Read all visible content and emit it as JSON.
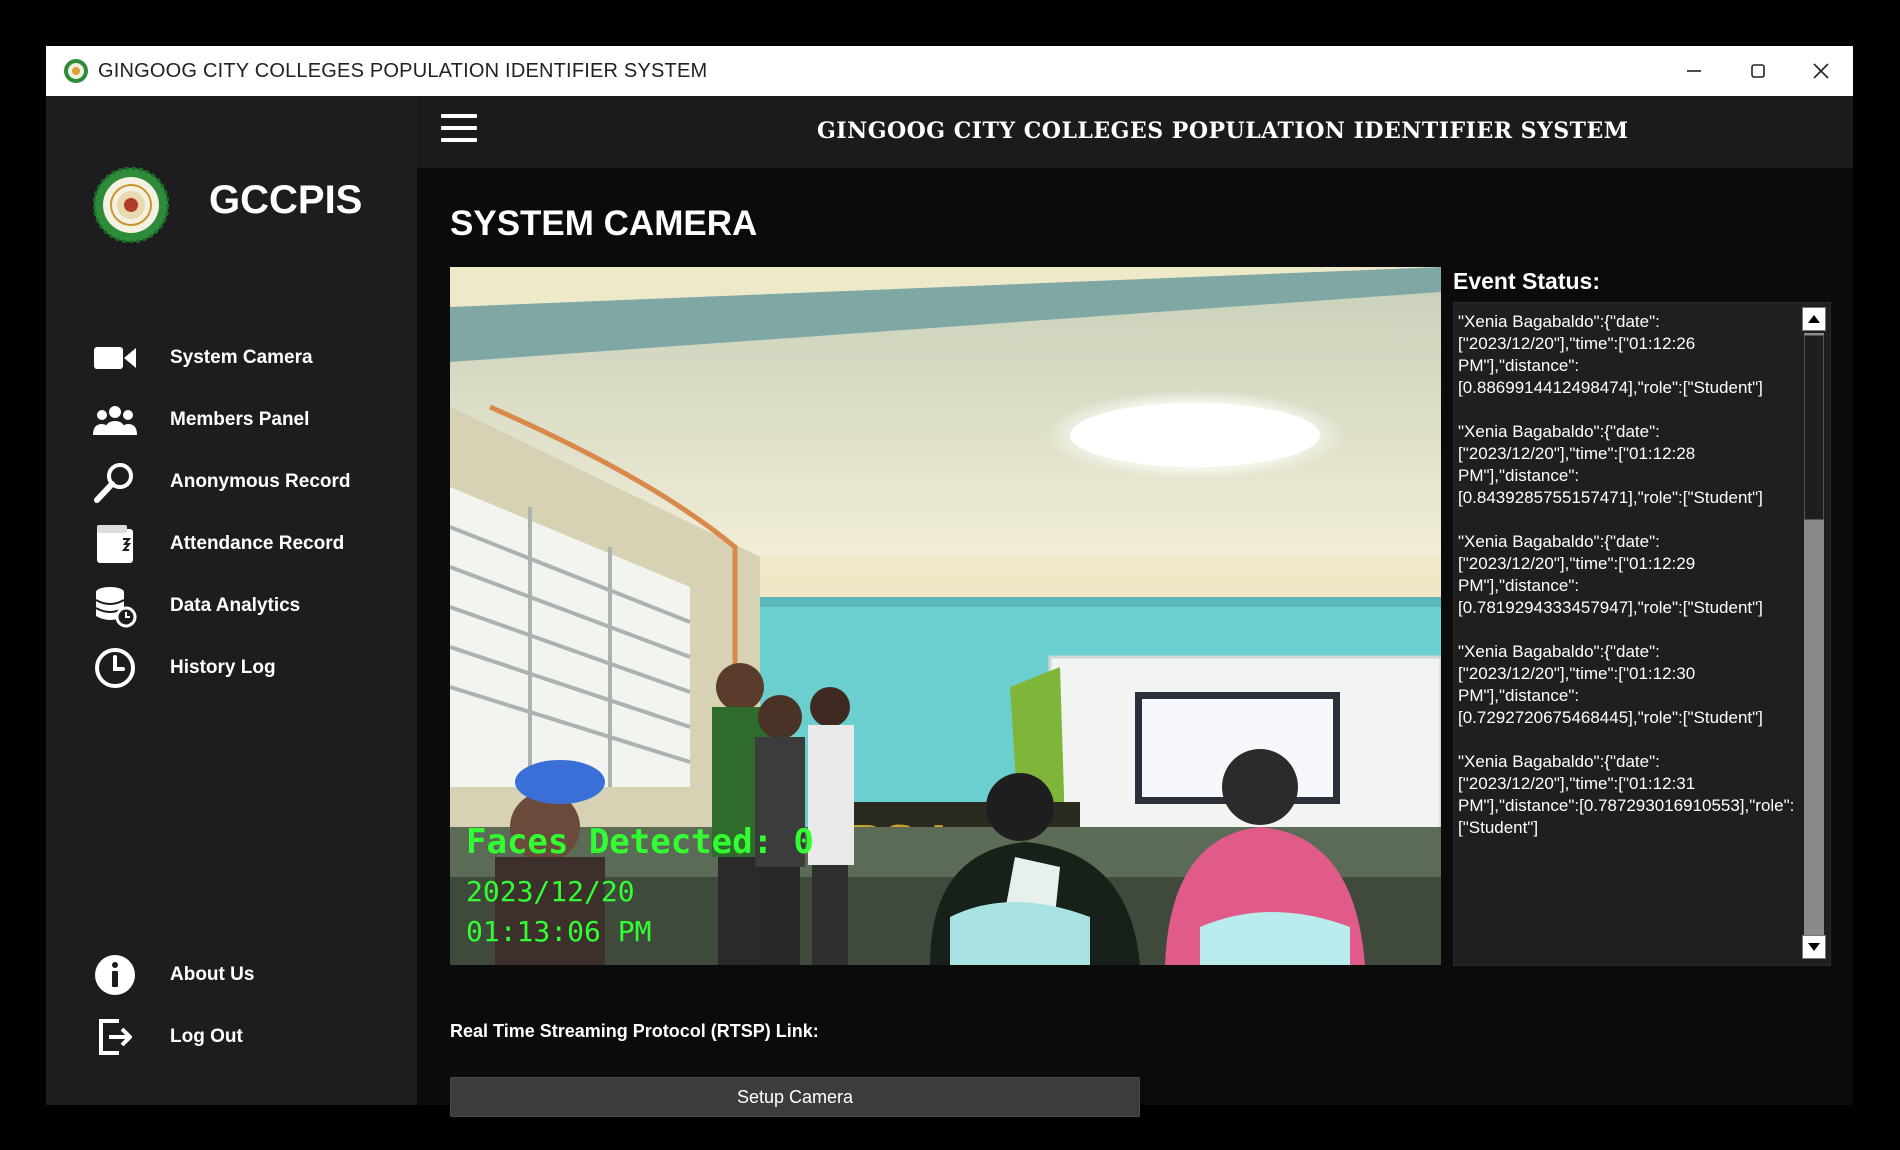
{
  "window": {
    "title": "GINGOOG CITY COLLEGES POPULATION IDENTIFIER SYSTEM",
    "minimize_icon": "minimize-icon",
    "maximize_icon": "maximize-icon",
    "close_icon": "close-icon"
  },
  "sidebar": {
    "brand": "GCCPIS",
    "items": [
      {
        "label": "System Camera",
        "icon": "video-camera-icon"
      },
      {
        "label": "Members Panel",
        "icon": "users-group-icon"
      },
      {
        "label": "Anonymous Record",
        "icon": "magnifier-icon"
      },
      {
        "label": "Attendance Record",
        "icon": "attendance-book-icon"
      },
      {
        "label": "Data Analytics",
        "icon": "database-analytics-icon"
      },
      {
        "label": "History Log",
        "icon": "clock-icon"
      }
    ],
    "bottom_items": [
      {
        "label": "About Us",
        "icon": "info-icon"
      },
      {
        "label": "Log Out",
        "icon": "logout-icon"
      }
    ]
  },
  "header": {
    "title": "GINGOOG CITY COLLEGES POPULATION IDENTIFIER SYSTEM"
  },
  "main": {
    "page_title": "SYSTEM CAMERA",
    "camera": {
      "faces_detected": "Faces Detected: 0",
      "date": "2023/12/20",
      "time": "01:13:06 PM"
    },
    "event_status": {
      "label": "Event Status:",
      "entries": [
        "\"Xenia Bagabaldo\":{\"date\":[\"2023/12/20\"],\"time\":[\"01:12:26 PM\"],\"distance\":[0.8869914412498474],\"role\":[\"Student\"]",
        "\"Xenia Bagabaldo\":{\"date\":[\"2023/12/20\"],\"time\":[\"01:12:28 PM\"],\"distance\":[0.8439285755157471],\"role\":[\"Student\"]",
        "\"Xenia Bagabaldo\":{\"date\":[\"2023/12/20\"],\"time\":[\"01:12:29 PM\"],\"distance\":[0.7819294333457947],\"role\":[\"Student\"]",
        "\"Xenia Bagabaldo\":{\"date\":[\"2023/12/20\"],\"time\":[\"01:12:30 PM\"],\"distance\":[0.7292720675468445],\"role\":[\"Student\"]",
        "\"Xenia Bagabaldo\":{\"date\":[\"2023/12/20\"],\"time\":[\"01:12:31 PM\"],\"distance\":[0.787293016910553],\"role\":[\"Student\"]"
      ]
    },
    "rtsp_label": "Real Time Streaming Protocol (RTSP) Link:",
    "setup_button": "Setup Camera"
  },
  "colors": {
    "overlay_text": "#32ff32",
    "sidebar_bg": "#1d1d1f",
    "main_bg": "#0b0b0b",
    "logo_green": "#2e8b3a"
  }
}
